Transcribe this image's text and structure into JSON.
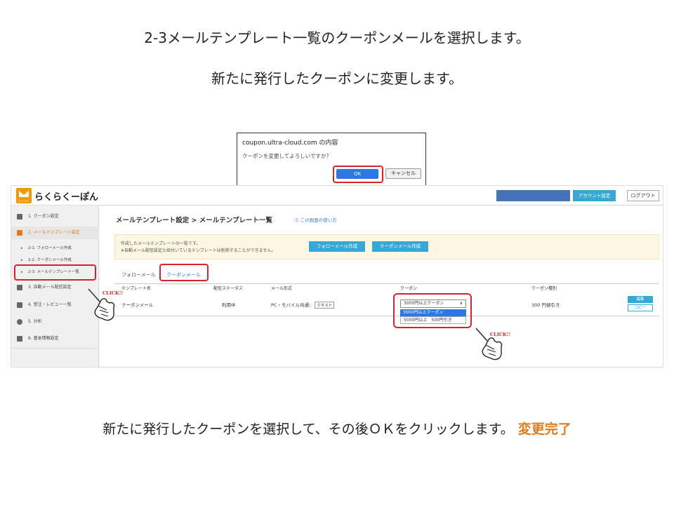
{
  "captions": {
    "line1": "2-3メールテンプレート一覧のクーポンメールを選択します。",
    "line2": "新たに発行したクーポンに変更します。",
    "bottom_main": "新たに発行したクーポンを選択して、その後ＯＫをクリックします。",
    "bottom_done": "変更完了",
    "done_color": "#e07b1a"
  },
  "dialog": {
    "title": "coupon.ultra-cloud.com の内容",
    "message": "クーポンを変更してよろしいですか？",
    "ok_label": "OK",
    "cancel_label": "キャンセル"
  },
  "app": {
    "logo_text": "らくらくーぽん",
    "logo_sub": "らくらく",
    "account_button": "アカウント設定",
    "logout_button": "ログアウト",
    "sidebar": {
      "items": [
        {
          "label": "1. クーポン設定",
          "icon": "coupon-icon"
        },
        {
          "label": "2. メールテンプレート設定",
          "icon": "mail-icon"
        },
        {
          "label": "3. 自動メール配信設定",
          "icon": "gears-icon"
        },
        {
          "label": "4. 受注・レビュー一覧",
          "icon": "list-icon"
        },
        {
          "label": "5. 分析",
          "icon": "pie-chart-icon"
        },
        {
          "label": "6. 基本情報設定",
          "icon": "gear-icon"
        }
      ],
      "subitems": [
        {
          "label": "2-1. フォローメール作成"
        },
        {
          "label": "2-2. クーポンメール作成"
        },
        {
          "label": "2-3. メールテンプレート一覧"
        }
      ]
    },
    "main": {
      "title": "メールテンプレート設定 > メールテンプレート一覧",
      "howto": "⓵ この画面の使い方",
      "info_line1": "作成したメールテンプレートの一覧です。",
      "info_line2": "※自動メール配信設定と紐付いているテンプレートは削除することができません。",
      "btn_follow": "フォローメール作成",
      "btn_coupon": "クーポンメール作成",
      "tabs": [
        "フォローメール",
        "クーポンメール"
      ],
      "table": {
        "headers": [
          "テンプレート名",
          "配信ステータス",
          "メール形式",
          "クーポン",
          "クーポン種別"
        ],
        "row": {
          "name": "クーポンメール",
          "status": "利用中",
          "format": "PC・モバイル共通：",
          "format_tag": "テキスト",
          "type": "300 円値引き",
          "edit": "編集",
          "copy": "コピー"
        }
      },
      "dropdown": {
        "selected": "3000円以上クーポン",
        "options": [
          "3000円以上クーポン",
          "5000円以上　500円引き"
        ]
      }
    },
    "click_label": "CLICK!!"
  }
}
